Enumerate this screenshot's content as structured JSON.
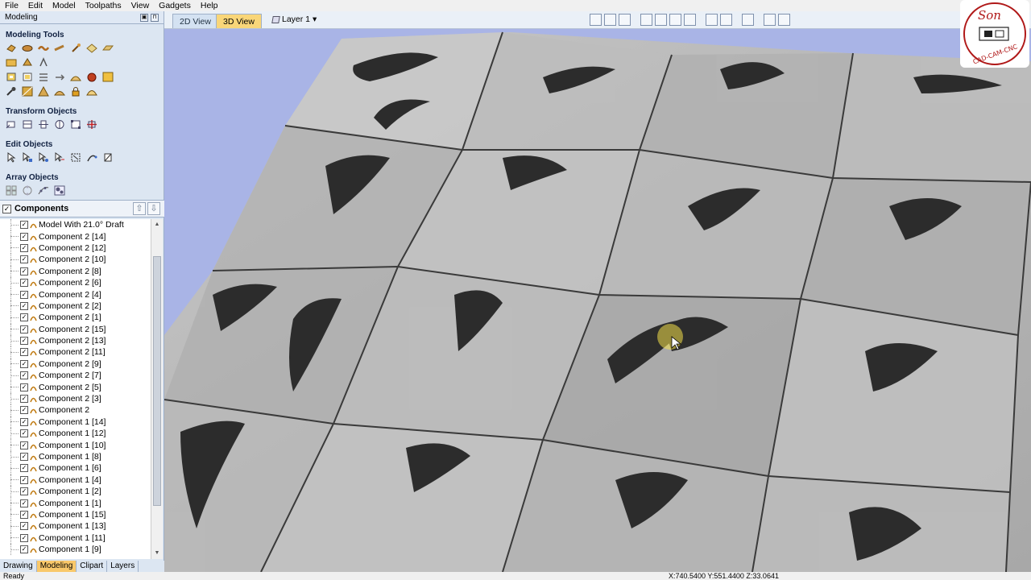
{
  "menu": [
    "File",
    "Edit",
    "Model",
    "Toolpaths",
    "View",
    "Gadgets",
    "Help"
  ],
  "panel": {
    "title": "Modeling"
  },
  "sections": {
    "modeling_tools": "Modeling Tools",
    "transform_objects": "Transform Objects",
    "edit_objects": "Edit Objects",
    "array_objects": "Array Objects"
  },
  "components": {
    "title": "Components",
    "items": [
      "Model With 21.0° Draft",
      "Component 2 [14]",
      "Component 2 [12]",
      "Component 2 [10]",
      "Component 2 [8]",
      "Component 2 [6]",
      "Component 2 [4]",
      "Component 2 [2]",
      "Component 2 [1]",
      "Component 2 [15]",
      "Component 2 [13]",
      "Component 2 [11]",
      "Component 2 [9]",
      "Component 2 [7]",
      "Component 2 [5]",
      "Component 2 [3]",
      "Component 2",
      "Component 1 [14]",
      "Component 1 [12]",
      "Component 1 [10]",
      "Component 1 [8]",
      "Component 1 [6]",
      "Component 1 [4]",
      "Component 1 [2]",
      "Component 1 [1]",
      "Component 1 [15]",
      "Component 1 [13]",
      "Component 1 [11]",
      "Component 1 [9]"
    ]
  },
  "bottom_tabs": [
    "Drawing",
    "Modeling",
    "Clipart",
    "Layers"
  ],
  "active_bottom_tab": "Modeling",
  "view_tabs": {
    "two_d": "2D View",
    "three_d": "3D View"
  },
  "layer": "Layer 1",
  "status": {
    "left": "Ready",
    "coords": "X:740.5400 Y:551.4400 Z:33.0641"
  },
  "colors": {
    "viewport_bg": "#a9b4e6",
    "active_tab": "#f9d679",
    "panel_bg": "#dce6f2"
  }
}
